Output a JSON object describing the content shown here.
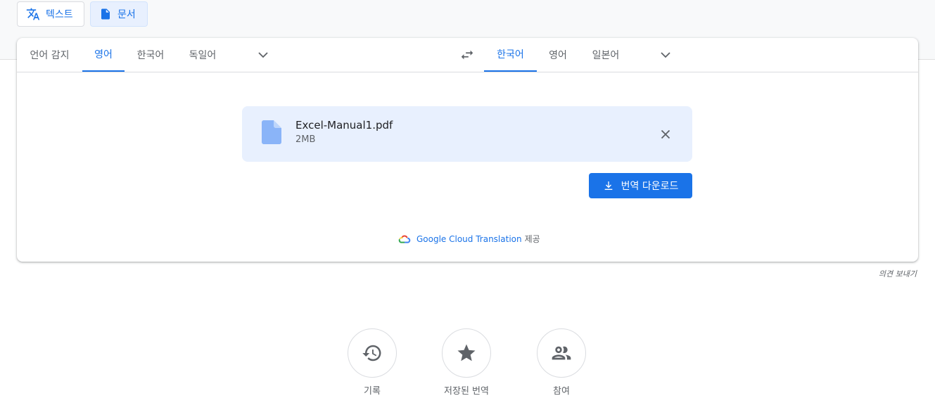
{
  "mode_tabs": {
    "text_label": "텍스트",
    "document_label": "문서"
  },
  "source_languages": {
    "detect": "언어 감지",
    "items": [
      "영어",
      "한국어",
      "독일어"
    ],
    "active": "영어"
  },
  "target_languages": {
    "items": [
      "한국어",
      "영어",
      "일본어"
    ],
    "active": "한국어"
  },
  "file": {
    "name": "Excel-Manual1.pdf",
    "size": "2MB"
  },
  "download_label": "번역 다운로드",
  "powered_by": {
    "brand": "Google Cloud Translation",
    "suffix": "제공"
  },
  "feedback_label": "의견 보내기",
  "bottom_actions": {
    "history": "기록",
    "saved": "저장된 번역",
    "community": "참여"
  },
  "colors": {
    "accent": "#1a73e8",
    "file_bg": "#e8f0fe"
  },
  "icons": [
    "translate-icon",
    "document-icon",
    "chevron-down-icon",
    "swap-icon",
    "file-icon",
    "close-icon",
    "download-icon",
    "google-cloud-icon",
    "history-icon",
    "star-icon",
    "people-icon"
  ]
}
